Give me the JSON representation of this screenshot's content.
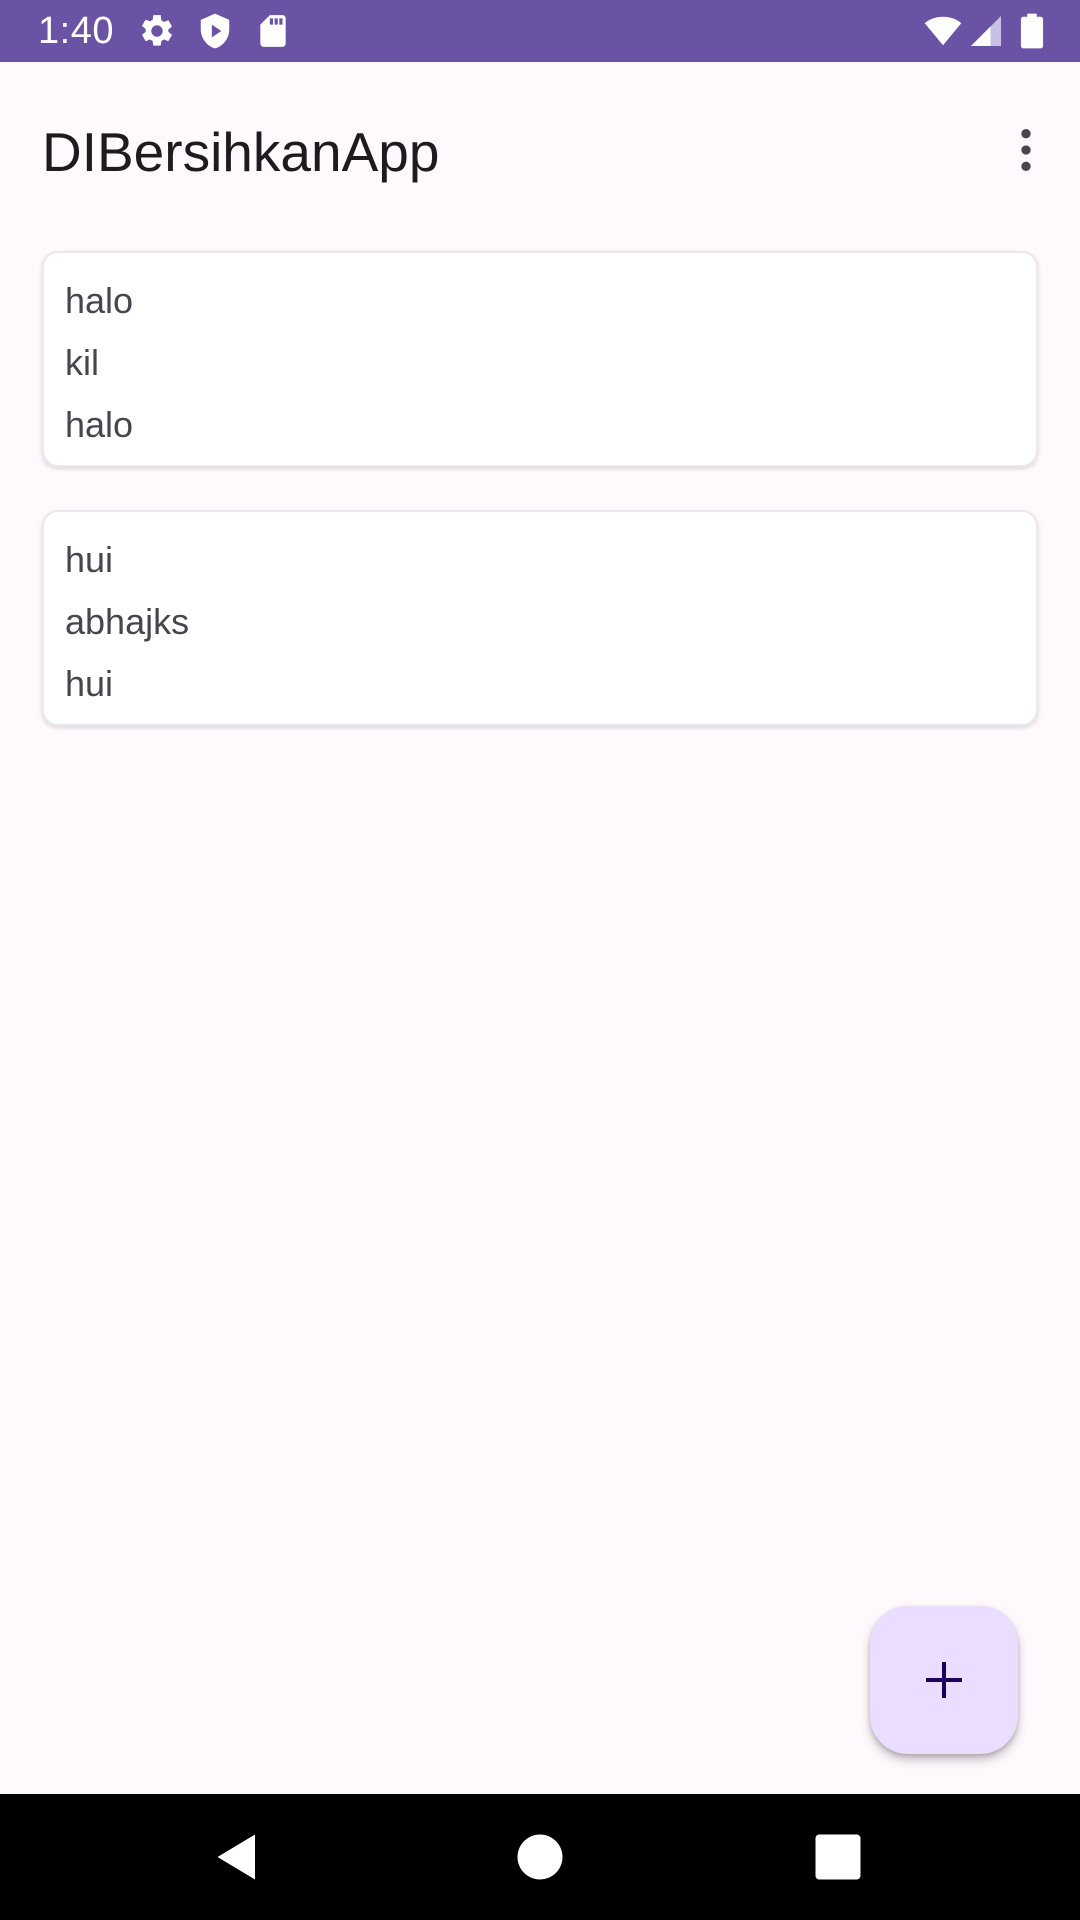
{
  "status_bar": {
    "time": "1:40",
    "icons": [
      "gear-icon",
      "shield-icon",
      "sd-card-icon",
      "wifi-icon",
      "cell-signal-icon",
      "battery-icon"
    ],
    "background": "#6A52A4"
  },
  "app_bar": {
    "title": "DIBersihkanApp",
    "overflow_icon": "more-vert-icon"
  },
  "notes": [
    {
      "line1": "halo",
      "line2": "kil",
      "line3": "halo"
    },
    {
      "line1": "hui",
      "line2": "abhajks",
      "line3": "hui"
    }
  ],
  "fab": {
    "icon": "add-icon",
    "background": "#EADDFF",
    "icon_color": "#21005D"
  },
  "nav_bar": {
    "buttons": [
      "back-icon",
      "home-icon",
      "recents-icon"
    ]
  },
  "colors": {
    "surface": "#FFF8FD",
    "card": "#FFFFFF",
    "title_text": "#1D1B20",
    "body_text": "#49454F"
  }
}
